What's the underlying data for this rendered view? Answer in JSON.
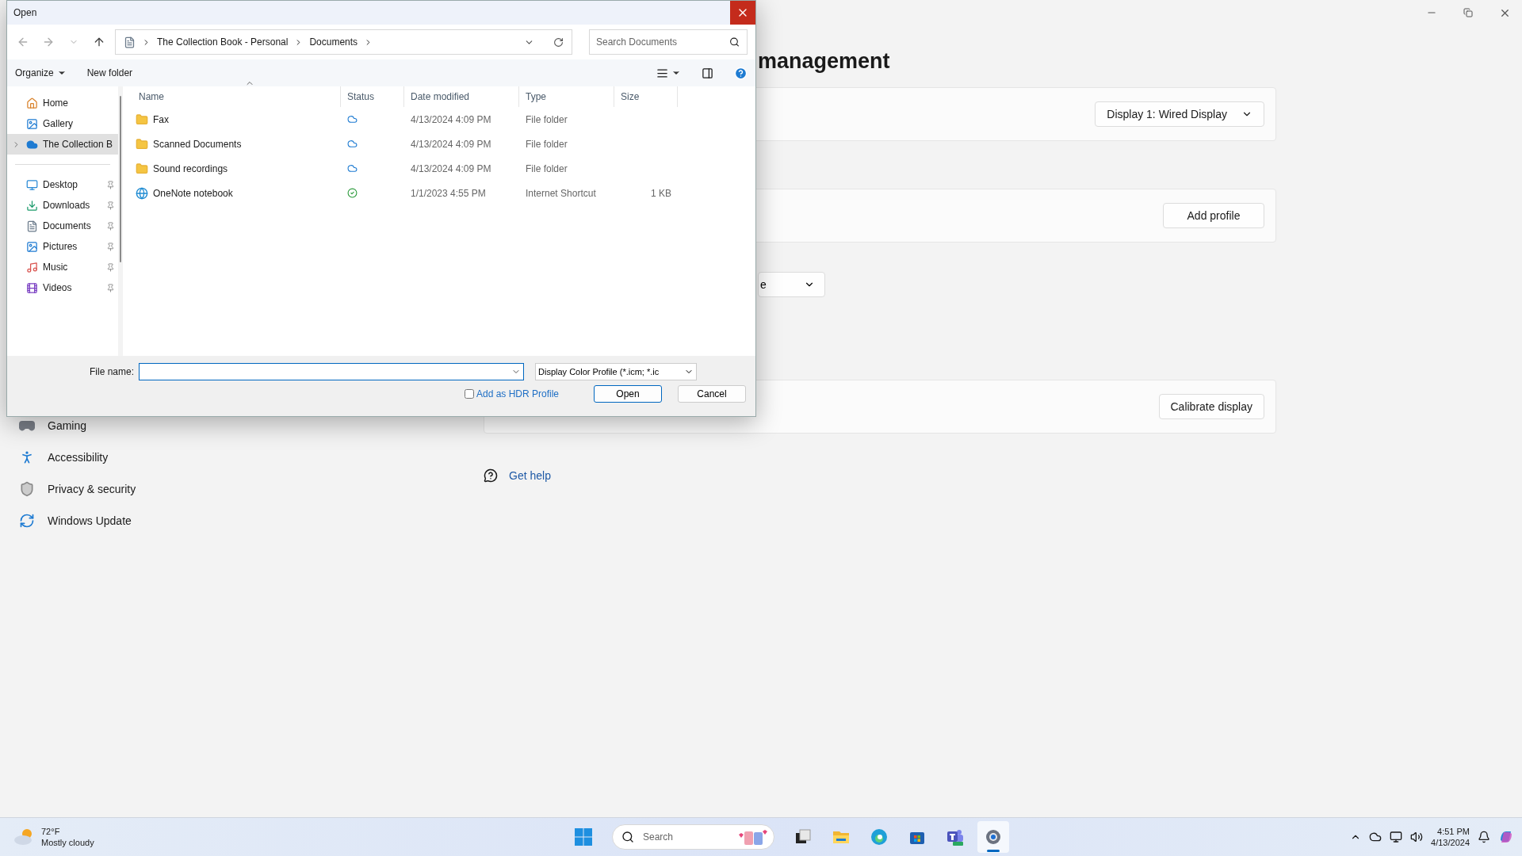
{
  "settings": {
    "heading": "management",
    "sidebar": [
      {
        "label": "Gaming",
        "kind": "gaming"
      },
      {
        "label": "Accessibility",
        "kind": "accessibility"
      },
      {
        "label": "Privacy & security",
        "kind": "privacy"
      },
      {
        "label": "Windows Update",
        "kind": "update"
      }
    ],
    "display_dropdown": "Display 1: Wired Display",
    "add_profile_button": "Add profile",
    "partial_dropdown": "e",
    "calibrate_button": "Calibrate display",
    "get_help": "Get help"
  },
  "dialog": {
    "title": "Open",
    "breadcrumbs": [
      "The Collection Book - Personal",
      "Documents"
    ],
    "search": {
      "placeholder": "Search Documents"
    },
    "toolbar": [
      "Organize",
      "New folder"
    ],
    "nav_groups": [
      [
        {
          "label": "Home",
          "kind": "home",
          "selected": false,
          "pinned": false,
          "expandable": false
        },
        {
          "label": "Gallery",
          "kind": "gallery",
          "selected": false,
          "pinned": false,
          "expandable": false
        },
        {
          "label": "The Collection B",
          "kind": "cloud",
          "selected": true,
          "pinned": false,
          "expandable": true
        }
      ],
      [
        {
          "label": "Desktop",
          "kind": "desktop",
          "selected": false,
          "pinned": true,
          "expandable": false
        },
        {
          "label": "Downloads",
          "kind": "downloads",
          "selected": false,
          "pinned": true,
          "expandable": false
        },
        {
          "label": "Documents",
          "kind": "documents",
          "selected": false,
          "pinned": true,
          "expandable": false
        },
        {
          "label": "Pictures",
          "kind": "pictures",
          "selected": false,
          "pinned": true,
          "expandable": false
        },
        {
          "label": "Music",
          "kind": "music",
          "selected": false,
          "pinned": true,
          "expandable": false
        },
        {
          "label": "Videos",
          "kind": "videos",
          "selected": false,
          "pinned": true,
          "expandable": false
        }
      ]
    ],
    "columns": [
      "Name",
      "Status",
      "Date modified",
      "Type",
      "Size"
    ],
    "files": [
      {
        "name": "Fax",
        "kind": "folder",
        "synced": false,
        "date": "4/13/2024 4:09 PM",
        "type": "File folder"
      },
      {
        "name": "Scanned Documents",
        "kind": "folder",
        "synced": false,
        "date": "4/13/2024 4:09 PM",
        "type": "File folder"
      },
      {
        "name": "Sound recordings",
        "kind": "folder",
        "synced": false,
        "date": "4/13/2024 4:09 PM",
        "type": "File folder"
      },
      {
        "name": "OneNote notebook",
        "kind": "shortcut",
        "synced": true,
        "date": "1/1/2023 4:55 PM",
        "type": "Internet Shortcut",
        "size": "1 KB"
      }
    ],
    "file_name_label": "File name:",
    "file_type": "Display Color Profile (*.icm; *.ic",
    "hdr_checkbox": {
      "label": "Add as HDR Profile",
      "checked": false
    },
    "buttons": [
      "Open",
      "Cancel"
    ]
  },
  "taskbar": {
    "weather": {
      "temperature": "72°F",
      "condition": "Mostly cloudy"
    },
    "search": {
      "placeholder": "Search"
    },
    "apps": [
      {
        "kind": "task-view",
        "active": false
      },
      {
        "kind": "explorer",
        "active": false
      },
      {
        "kind": "edge",
        "active": false
      },
      {
        "kind": "store",
        "active": false
      },
      {
        "kind": "teams",
        "active": false
      },
      {
        "kind": "settings",
        "active": true
      }
    ],
    "time": "4:51 PM",
    "date": "4/13/2024"
  }
}
